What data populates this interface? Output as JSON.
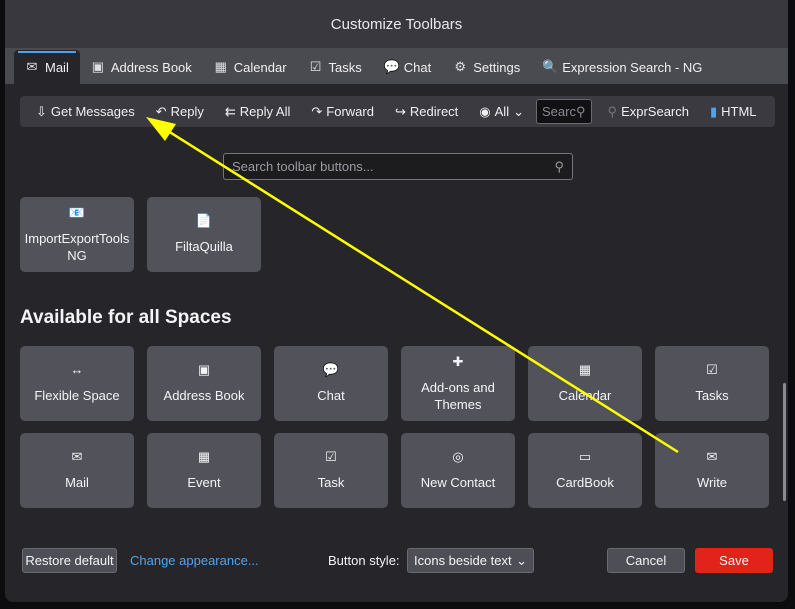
{
  "title": "Customize Toolbars",
  "tabs": [
    {
      "label": "Mail",
      "icon": "envelope-icon",
      "glyph": "✉"
    },
    {
      "label": "Address Book",
      "icon": "address-book-icon",
      "glyph": "▣"
    },
    {
      "label": "Calendar",
      "icon": "calendar-icon",
      "glyph": "▦"
    },
    {
      "label": "Tasks",
      "icon": "clipboard-icon",
      "glyph": "☑"
    },
    {
      "label": "Chat",
      "icon": "chat-icon",
      "glyph": "💬"
    },
    {
      "label": "Settings",
      "icon": "gear-icon",
      "glyph": "⚙"
    },
    {
      "label": "Expression Search - NG",
      "icon": "magnifier-icon",
      "glyph": "🔍"
    }
  ],
  "toolbar": {
    "get_messages": "Get Messages",
    "reply": "Reply",
    "reply_all": "Reply All",
    "forward": "Forward",
    "redirect": "Redirect",
    "all": "All",
    "search_placeholder": "Search",
    "exprsearch": "ExprSearch",
    "html": "HTML"
  },
  "search": {
    "placeholder": "Search toolbar buttons..."
  },
  "extension_tiles": [
    {
      "label": "ImportExportTools NG",
      "glyph": "📧"
    },
    {
      "label": "FiltaQuilla",
      "glyph": "📄"
    }
  ],
  "section_heading": "Available for all Spaces",
  "tiles": [
    {
      "label": "Flexible Space",
      "glyph": "↔",
      "icon": "flexible-space-icon"
    },
    {
      "label": "Address Book",
      "glyph": "▣",
      "icon": "address-book-icon"
    },
    {
      "label": "Chat",
      "glyph": "💬",
      "icon": "chat-icon"
    },
    {
      "label": "Add-ons and Themes",
      "glyph": "✚",
      "icon": "puzzle-icon"
    },
    {
      "label": "Calendar",
      "glyph": "▦",
      "icon": "calendar-icon"
    },
    {
      "label": "Tasks",
      "glyph": "☑",
      "icon": "clipboard-icon"
    },
    {
      "label": "Mail",
      "glyph": "✉",
      "icon": "envelope-icon"
    },
    {
      "label": "Event",
      "glyph": "▦",
      "icon": "event-icon"
    },
    {
      "label": "Task",
      "glyph": "☑",
      "icon": "task-icon"
    },
    {
      "label": "New Contact",
      "glyph": "◎",
      "icon": "new-contact-icon"
    },
    {
      "label": "CardBook",
      "glyph": "▭",
      "icon": "cardbook-icon"
    },
    {
      "label": "Write",
      "glyph": "✉",
      "icon": "write-icon"
    }
  ],
  "footer": {
    "restore": "Restore default",
    "change_appearance": "Change appearance...",
    "button_style_label": "Button style:",
    "button_style_value": "Icons beside text",
    "cancel": "Cancel",
    "save": "Save"
  },
  "colors": {
    "accent": "#4aa3ef",
    "save": "#e2231b",
    "annotation": "#ffff00"
  }
}
